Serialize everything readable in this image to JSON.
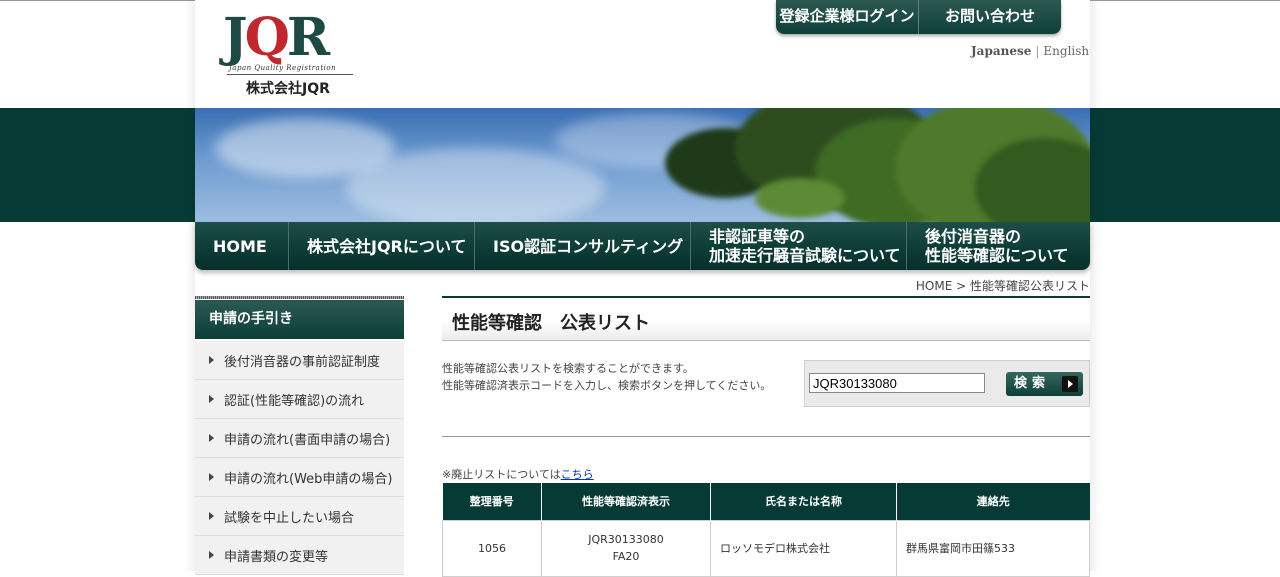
{
  "header": {
    "logo_text_j": "J",
    "logo_text_q": "Q",
    "logo_text_r": "R",
    "logo_sub": "Japan Quality Registration",
    "company_name": "株式会社JQR",
    "top_tabs": [
      "登録企業様ログイン",
      "お問い合わせ"
    ],
    "languages": {
      "active": "Japanese",
      "separator": "|",
      "other": "English"
    }
  },
  "nav": {
    "items": [
      {
        "label": "HOME"
      },
      {
        "label": "株式会社JQRについて"
      },
      {
        "label": "ISO認証コンサルティング"
      },
      {
        "line1": "非認証車等の",
        "line2": "加速走行騒音試験について"
      },
      {
        "line1": "後付消音器の",
        "line2": "性能等確認について"
      }
    ]
  },
  "breadcrumb": "HOME > 性能等確認公表リスト",
  "sidebar": {
    "heading": "申請の手引き",
    "items": [
      {
        "label": "後付消音器の事前認証制度"
      },
      {
        "label": "認証(性能等確認)の流れ"
      },
      {
        "label": "申請の流れ(書面申請の場合)"
      },
      {
        "label": "申請の流れ(Web申請の場合)"
      },
      {
        "label": "試験を中止したい場合"
      },
      {
        "label": "申請書類の変更等"
      }
    ]
  },
  "main": {
    "title": "性能等確認　公表リスト",
    "description_line1": "性能等確認公表リストを検索することができます。",
    "description_line2": "性能等確認済表示コードを入力し、検索ボタンを押してください。",
    "search": {
      "value": "JQR30133080",
      "button_label": "検索"
    },
    "note_prefix": "※廃止リストについては",
    "note_link": "こちら",
    "table": {
      "headers": [
        "整理番号",
        "性能等確認済表示",
        "氏名または名称",
        "連絡先"
      ],
      "rows": [
        {
          "id": "1056",
          "code_line1": "JQR30133080",
          "code_line2": "FA20",
          "name": "ロッソモデロ株式会社",
          "contact": "群馬県富岡市田篠533"
        }
      ]
    }
  },
  "colors": {
    "brand_dark": "#063a35",
    "logo_red": "#c0282d",
    "link": "#0033cc"
  }
}
